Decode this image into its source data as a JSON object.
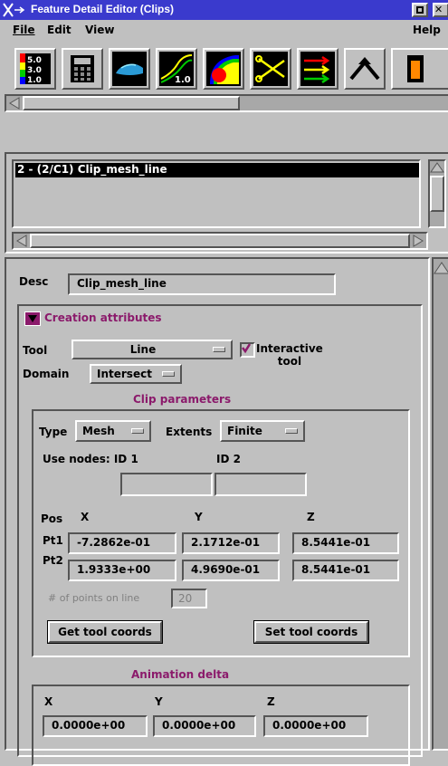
{
  "window": {
    "title": "Feature Detail Editor (Clips)"
  },
  "menu": {
    "file": "File",
    "edit": "Edit",
    "view": "View",
    "help": "Help"
  },
  "toolbar": {
    "icons": [
      "color-legend-icon",
      "calculator-icon",
      "car-model-icon",
      "graph-curves-icon",
      "color-contour-icon",
      "scissors-icon",
      "vectors-icon",
      "arrow-up-icon",
      "partial-icon"
    ],
    "legend_values": [
      "5.0",
      "3.0",
      "1.0"
    ],
    "curve_label": "1.0"
  },
  "feature_list": {
    "selected_item": "2 - (2/C1) Clip_mesh_line"
  },
  "desc": {
    "label": "Desc",
    "value": "Clip_mesh_line"
  },
  "creation": {
    "header": "Creation attributes",
    "tool_label": "Tool",
    "tool_value": "Line",
    "interactive_label_1": "Interactive",
    "interactive_label_2": "tool",
    "interactive_checked": true,
    "domain_label": "Domain",
    "domain_value": "Intersect"
  },
  "clip": {
    "header": "Clip parameters",
    "type_label": "Type",
    "type_value": "Mesh",
    "extents_label": "Extents",
    "extents_value": "Finite",
    "use_nodes_label": "Use nodes: ID 1",
    "id2_label": "ID 2",
    "id1_value": "",
    "id2_value": "",
    "pos_label": "Pos",
    "col_x": "X",
    "col_y": "Y",
    "col_z": "Z",
    "pt1_label": "Pt1",
    "pt2_label": "Pt2",
    "pt1": [
      "-7.2862e-01",
      "2.1712e-01",
      "8.5441e-01"
    ],
    "pt2": [
      "1.9333e+00",
      "4.9690e-01",
      "8.5441e-01"
    ],
    "points_label": "# of points on line",
    "points_value": "20",
    "get_coords": "Get tool coords",
    "set_coords": "Set tool coords"
  },
  "animation": {
    "header": "Animation delta",
    "col_x": "X",
    "col_y": "Y",
    "col_z": "Z",
    "values": [
      "0.0000e+00",
      "0.0000e+00",
      "0.0000e+00"
    ]
  },
  "colors": {
    "title_bar": "#3a3acd",
    "accent": "#8b1a6b",
    "selection": "#000000"
  }
}
